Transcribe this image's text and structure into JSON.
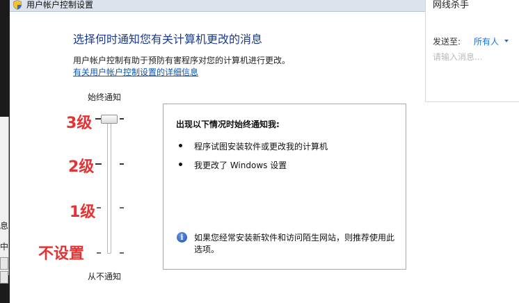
{
  "window": {
    "title": "用户帐户控制设置",
    "heading": "选择何时通知您有关计算机更改的消息",
    "description": "用户帐户控制有助于预防有害程序对您的计算机进行更改。",
    "detail_link": "有关用户帐户控制设置的详细信息"
  },
  "slider": {
    "top_label": "始终通知",
    "bottom_label": "从不通知",
    "selected_level": "3级",
    "levels": [
      "3级",
      "2级",
      "1级",
      "不设置"
    ]
  },
  "info_box": {
    "heading": "出现以下情况时始终通知我:",
    "bullets": [
      "程序试图安装软件或更改我的计算机",
      "我更改了 Windows 设置"
    ],
    "note": "如果您经常安装新软件和访问陌生网站，则推荐使用此选项。"
  },
  "chat_panel": {
    "title": "网线杀手",
    "send_label": "发送至:",
    "send_target": "所有人",
    "input_placeholder": "请输入消息..."
  },
  "background_window": {
    "edge_chars": [
      "息",
      "中"
    ]
  },
  "colors": {
    "level_label": "#e53333",
    "heading": "#1b3a8a",
    "link": "#0b57b8",
    "chat_target": "#1a6fd8"
  },
  "icons": {
    "title": "uac-shield-icon",
    "info": "info-icon",
    "dropdown": "chevron-down-icon"
  }
}
